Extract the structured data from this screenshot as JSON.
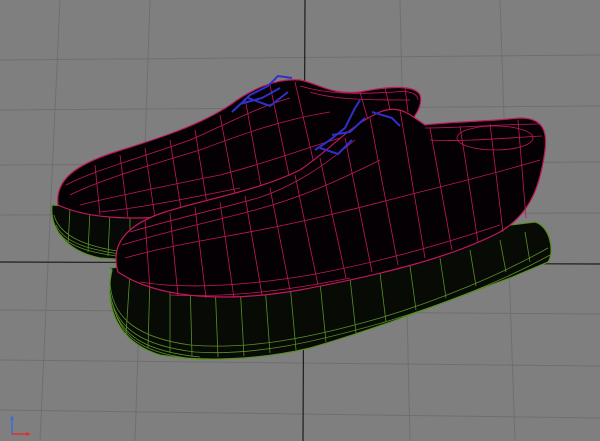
{
  "viewport": {
    "background": "#7f7f7f",
    "grid_color": "#6e6e6e",
    "grid_major_color": "#1a1a1a"
  },
  "model": {
    "shoes": [
      "left-shoe",
      "right-shoe"
    ],
    "upper_fill": "#050004",
    "upper_wire_color": "#c2185b",
    "sole_fill": "#070a05",
    "sole_wire_color": "#5a8f2a",
    "lace_color": "#3030c8"
  },
  "axis_gizmo": {
    "x_color": "#e03030",
    "y_color": "#3a6fd0"
  }
}
